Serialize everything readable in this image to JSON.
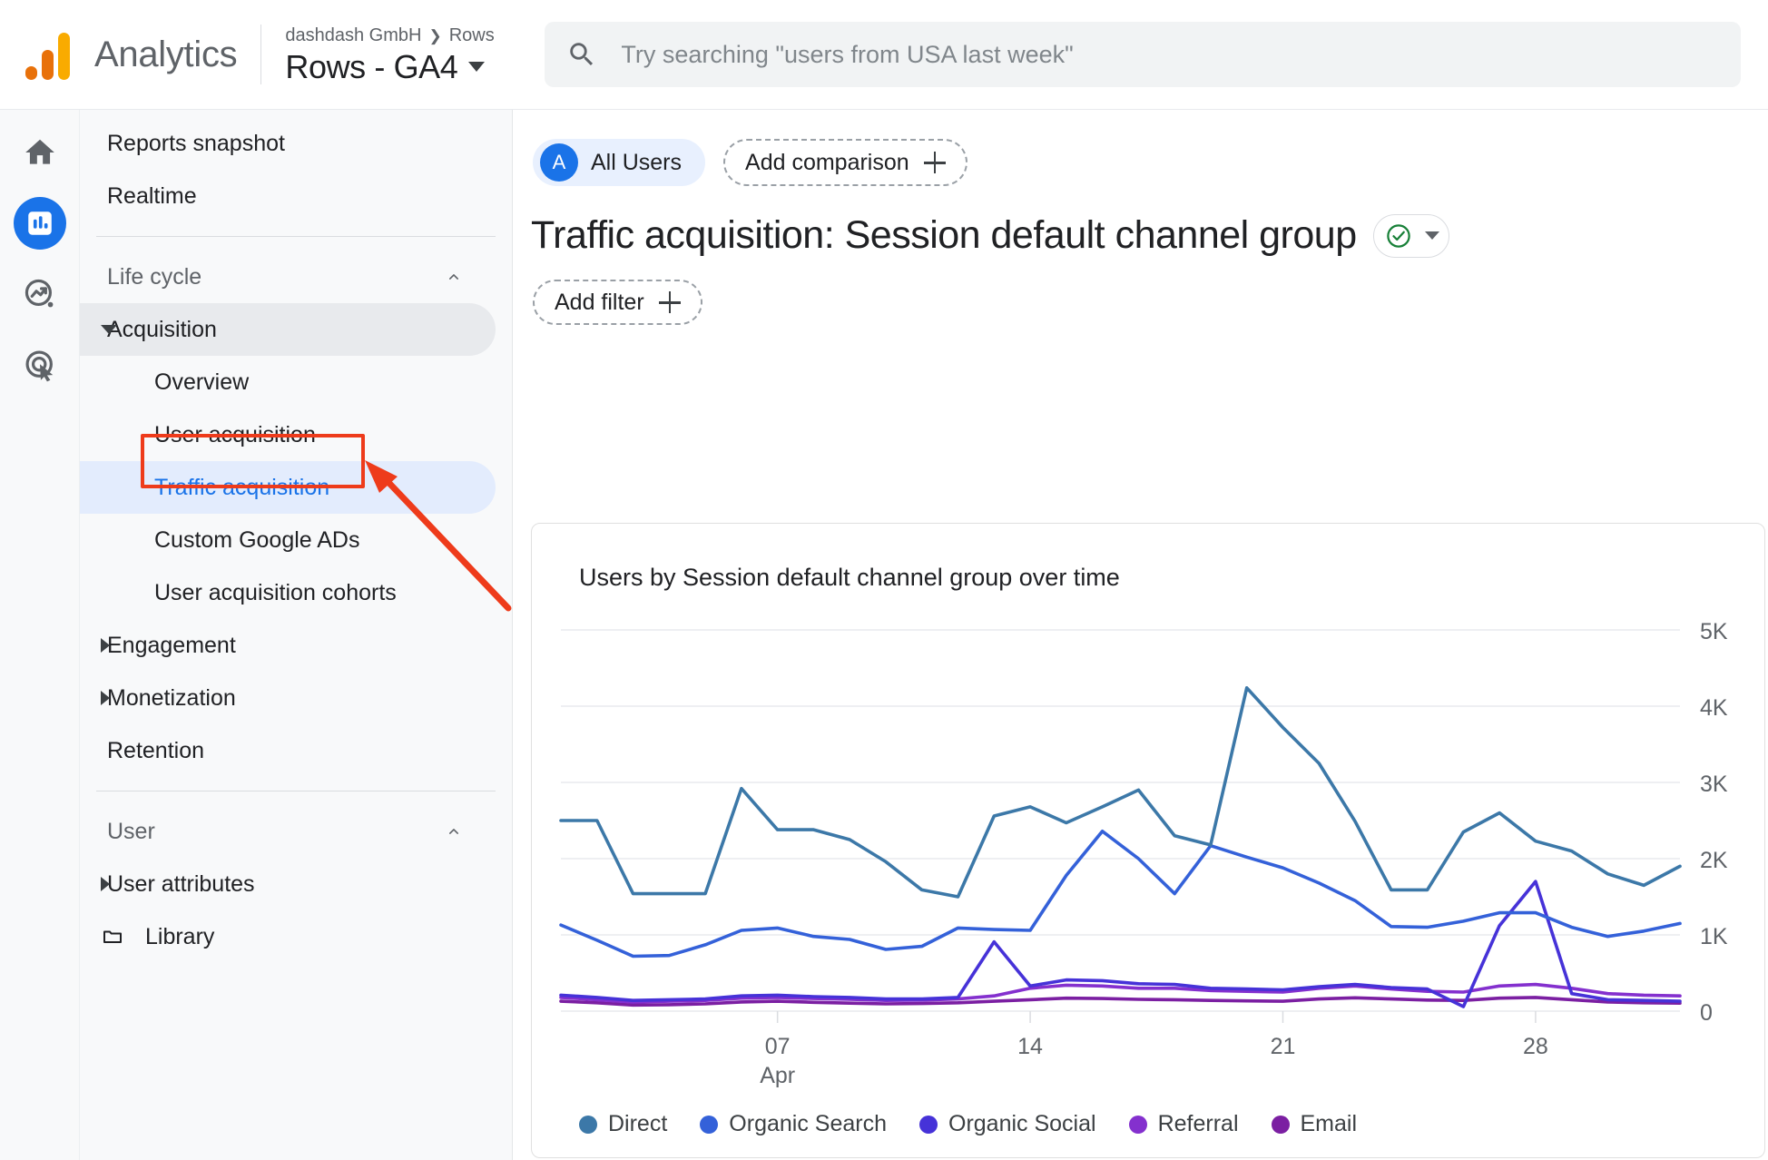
{
  "header": {
    "brand": "Analytics",
    "logo_icon": "ga-logo-icon",
    "breadcrumb_account": "dashdash GmbH",
    "breadcrumb_separator": "❯",
    "breadcrumb_property": "Rows",
    "property_name": "Rows - GA4",
    "property_caret_icon": "caret-down-icon",
    "search": {
      "icon": "search-icon",
      "placeholder": "Try searching \"users from USA last week\""
    }
  },
  "rail": {
    "items": [
      {
        "name": "home",
        "icon": "home-icon",
        "active": false
      },
      {
        "name": "reports",
        "icon": "bar-chart-icon",
        "active": true
      },
      {
        "name": "explore",
        "icon": "explore-trend-icon",
        "active": false
      },
      {
        "name": "advertising",
        "icon": "advertising-target-icon",
        "active": false
      }
    ]
  },
  "sidebar": {
    "items": [
      {
        "label": "Reports snapshot",
        "type": "top",
        "state": "default"
      },
      {
        "label": "Realtime",
        "type": "top",
        "state": "default"
      },
      {
        "label": "Life cycle",
        "type": "group",
        "state": "expanded",
        "chevron": "chevron-up-icon"
      },
      {
        "label": "Acquisition",
        "type": "top",
        "state": "selected-parent",
        "triangle": "triangle-down-icon"
      },
      {
        "label": "Overview",
        "type": "sub",
        "state": "default"
      },
      {
        "label": "User acquisition",
        "type": "sub",
        "state": "default"
      },
      {
        "label": "Traffic acquisition",
        "type": "sub",
        "state": "selected"
      },
      {
        "label": "Custom Google ADs",
        "type": "sub",
        "state": "default"
      },
      {
        "label": "User acquisition cohorts",
        "type": "sub",
        "state": "default"
      },
      {
        "label": "Engagement",
        "type": "top",
        "state": "collapsed",
        "triangle": "triangle-right-icon"
      },
      {
        "label": "Monetization",
        "type": "top",
        "state": "collapsed",
        "triangle": "triangle-right-icon"
      },
      {
        "label": "Retention",
        "type": "top",
        "state": "default"
      },
      {
        "label": "User",
        "type": "group",
        "state": "expanded",
        "chevron": "chevron-up-icon"
      },
      {
        "label": "User attributes",
        "type": "top",
        "state": "collapsed",
        "triangle": "triangle-right-icon"
      },
      {
        "label": "Library",
        "type": "top",
        "state": "default",
        "icon": "folder-icon"
      }
    ]
  },
  "main": {
    "audience_chip": {
      "avatar_letter": "A",
      "label": "All Users"
    },
    "add_comparison": {
      "label": "Add comparison",
      "icon": "plus-icon"
    },
    "page_title": "Traffic acquisition: Session default channel group",
    "title_badge": {
      "icon": "check-circle-icon",
      "caret": "caret-down-icon"
    },
    "add_filter": {
      "label": "Add filter",
      "icon": "plus-icon"
    }
  },
  "colors": {
    "accent_blue": "#1a73e8",
    "annotation_red": "#ee3b1b",
    "direct": "#3c78a8",
    "organic_search": "#3461d9",
    "organic_social": "#4632d8",
    "referral": "#8430ce",
    "email": "#7b1fa2"
  },
  "chart_data": {
    "type": "line",
    "title": "Users by Session default channel group over time",
    "xlabel": "",
    "ylabel": "",
    "ylim": [
      0,
      5000
    ],
    "yticks": [
      0,
      1000,
      2000,
      3000,
      4000,
      5000
    ],
    "ytick_labels": [
      "0",
      "1K",
      "2K",
      "3K",
      "4K",
      "5K"
    ],
    "xticks": [
      6,
      13,
      20,
      27
    ],
    "xtick_labels": [
      "07",
      "14",
      "21",
      "28"
    ],
    "xtick_sublabel": "Apr",
    "grid": true,
    "legend_position": "bottom",
    "x": [
      1,
      2,
      3,
      4,
      5,
      6,
      7,
      8,
      9,
      10,
      11,
      12,
      13,
      14,
      15,
      16,
      17,
      18,
      19,
      20,
      21,
      22,
      23,
      24,
      25,
      26,
      27,
      28,
      29,
      30,
      31,
      32
    ],
    "series": [
      {
        "name": "Direct",
        "color": "#3c78a8",
        "values": [
          2500,
          2500,
          1540,
          1540,
          1540,
          2920,
          2380,
          2380,
          2250,
          1960,
          1590,
          1500,
          2560,
          2680,
          2470,
          2680,
          2900,
          2300,
          2180,
          4240,
          3720,
          3250,
          2490,
          1590,
          1590,
          2350,
          2600,
          2230,
          2100,
          1800,
          1650,
          1900
        ]
      },
      {
        "name": "Organic Search",
        "color": "#3461d9",
        "values": [
          1130,
          930,
          720,
          730,
          870,
          1060,
          1090,
          980,
          940,
          810,
          850,
          1090,
          1070,
          1060,
          1780,
          2360,
          2000,
          1540,
          2170,
          2020,
          1880,
          1680,
          1450,
          1110,
          1100,
          1180,
          1290,
          1290,
          1100,
          980,
          1050,
          1150
        ]
      },
      {
        "name": "Organic Social",
        "color": "#4632d8",
        "values": [
          210,
          180,
          140,
          150,
          160,
          200,
          210,
          190,
          180,
          160,
          160,
          180,
          910,
          330,
          410,
          400,
          360,
          350,
          300,
          290,
          280,
          320,
          350,
          310,
          290,
          60,
          1120,
          1700,
          230,
          150,
          140,
          130
        ]
      },
      {
        "name": "Referral",
        "color": "#8430ce",
        "values": [
          180,
          150,
          120,
          130,
          140,
          170,
          180,
          165,
          155,
          140,
          145,
          160,
          200,
          300,
          340,
          330,
          300,
          300,
          270,
          260,
          250,
          300,
          330,
          290,
          260,
          250,
          330,
          350,
          300,
          230,
          210,
          200
        ]
      },
      {
        "name": "Email",
        "color": "#7b1fa2",
        "values": [
          130,
          110,
          80,
          85,
          95,
          120,
          130,
          115,
          105,
          95,
          100,
          110,
          130,
          150,
          170,
          165,
          155,
          150,
          140,
          135,
          130,
          160,
          175,
          160,
          145,
          140,
          170,
          180,
          150,
          120,
          110,
          105
        ]
      }
    ]
  }
}
